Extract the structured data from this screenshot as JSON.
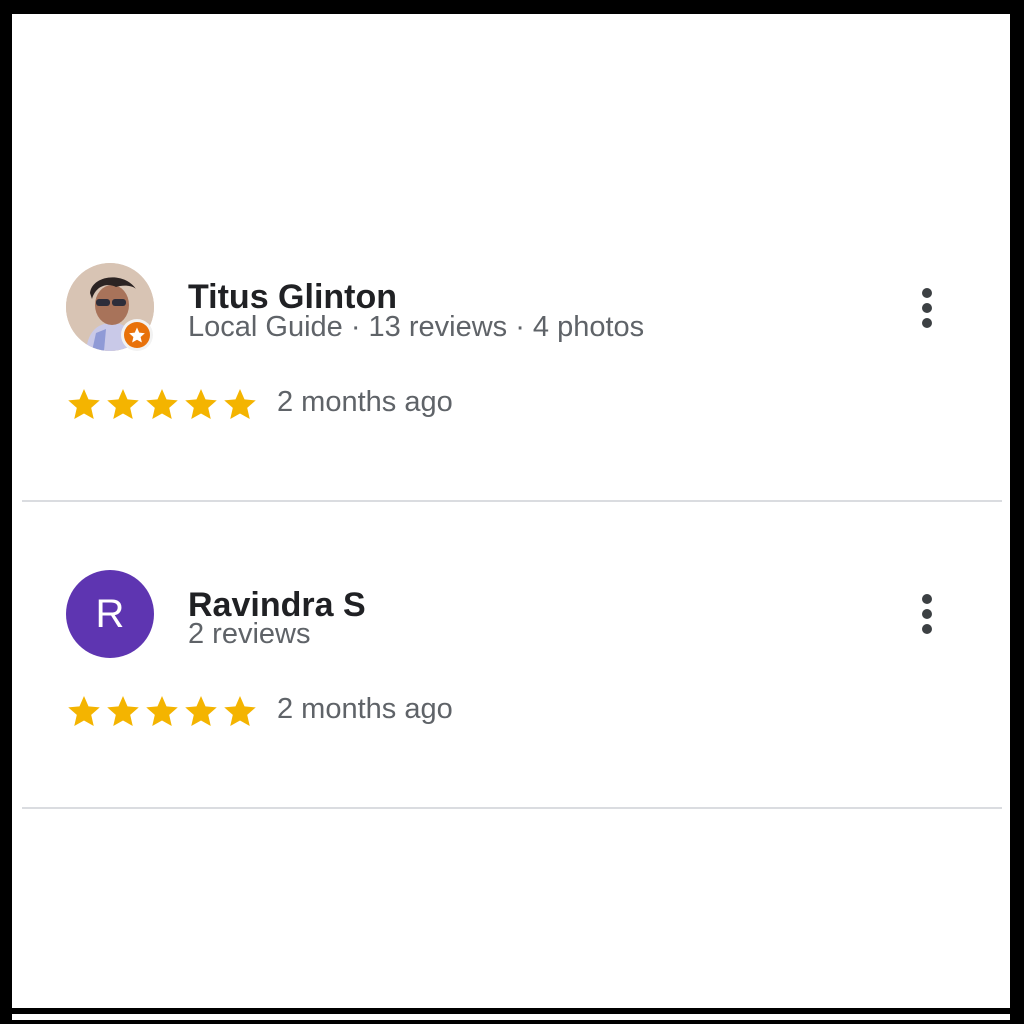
{
  "colors": {
    "star": "#f4b400",
    "avatar_purple": "#5e35b1",
    "local_guide_badge": "#e8710a"
  },
  "reviews": [
    {
      "author": "Titus Glinton",
      "meta": "Local Guide · 13 reviews · 4 photos",
      "avatar_type": "photo",
      "local_guide": true,
      "rating": 5,
      "time": "2 months ago"
    },
    {
      "author": "Ravindra S",
      "meta": "2 reviews",
      "avatar_type": "letter",
      "avatar_letter": "R",
      "local_guide": false,
      "rating": 5,
      "time": "2 months ago"
    }
  ],
  "icons": {
    "more": "more-vert-icon",
    "star": "star-icon",
    "badge": "local-guide-star-icon"
  }
}
